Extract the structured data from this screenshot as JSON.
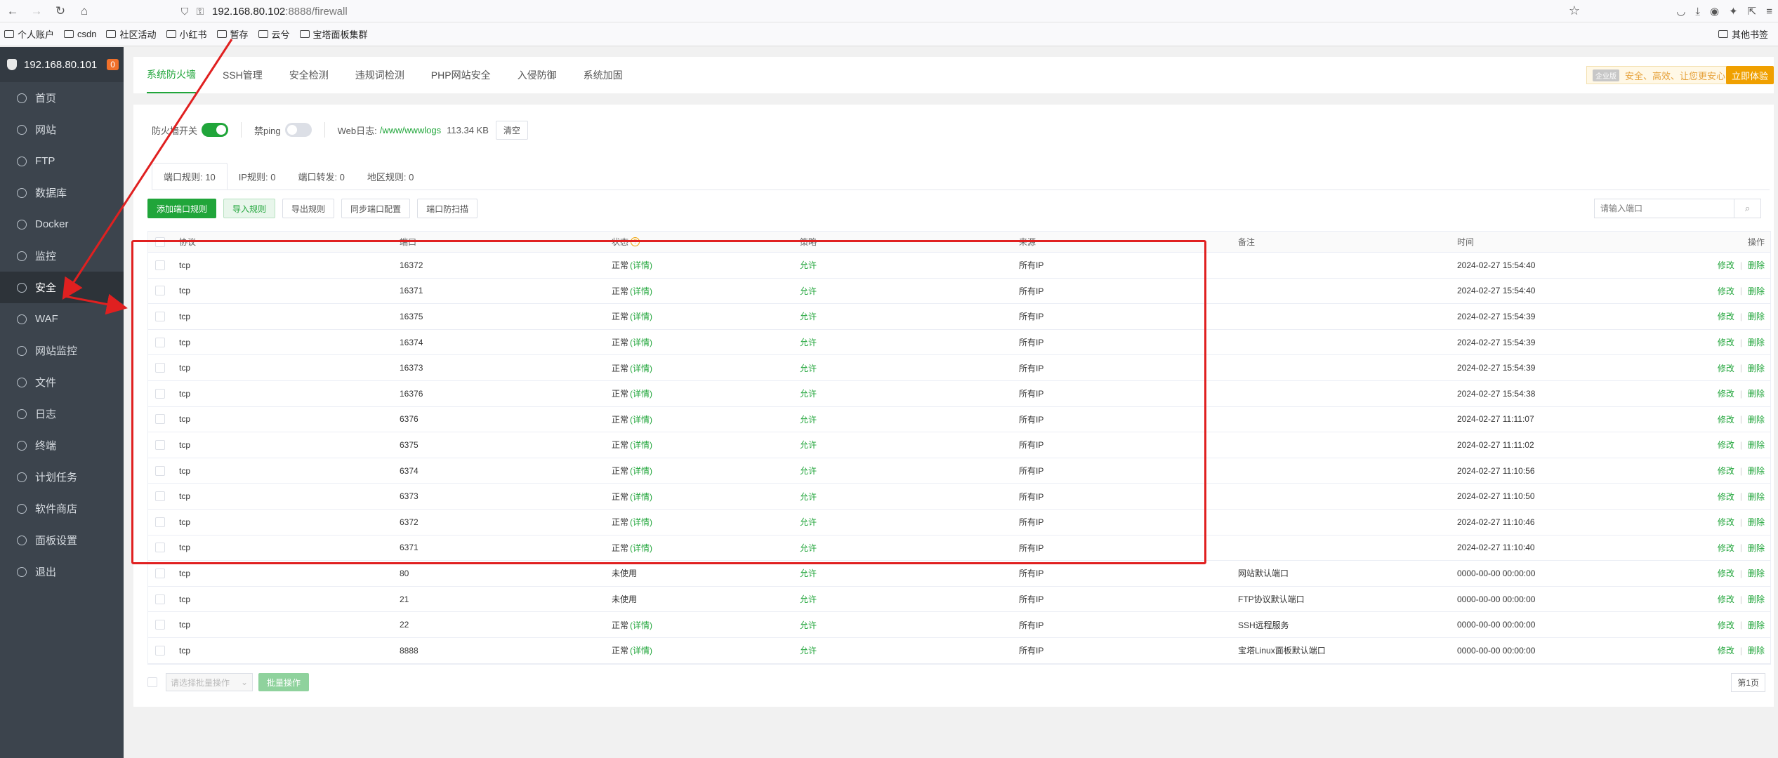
{
  "browser": {
    "url_host": "192.168.80.102",
    "url_rest": ":8888/firewall",
    "bookmarks": [
      "个人账户",
      "csdn",
      "社区活动",
      "小红书",
      "暂存",
      "云兮",
      "宝塔面板集群"
    ],
    "bookmark_right": "其他书签"
  },
  "sidebar": {
    "ip": "192.168.80.101",
    "badge": "0",
    "items": [
      {
        "label": "首页",
        "icon": "home-icon"
      },
      {
        "label": "网站",
        "icon": "globe-icon"
      },
      {
        "label": "FTP",
        "icon": "ftp-icon"
      },
      {
        "label": "数据库",
        "icon": "database-icon"
      },
      {
        "label": "Docker",
        "icon": "docker-icon"
      },
      {
        "label": "监控",
        "icon": "monitor-icon"
      },
      {
        "label": "安全",
        "icon": "shield-icon"
      },
      {
        "label": "WAF",
        "icon": "waf-icon"
      },
      {
        "label": "网站监控",
        "icon": "chart-icon"
      },
      {
        "label": "文件",
        "icon": "folder-icon"
      },
      {
        "label": "日志",
        "icon": "log-icon"
      },
      {
        "label": "终端",
        "icon": "terminal-icon"
      },
      {
        "label": "计划任务",
        "icon": "clock-icon"
      },
      {
        "label": "软件商店",
        "icon": "store-icon"
      },
      {
        "label": "面板设置",
        "icon": "gear-icon"
      },
      {
        "label": "退出",
        "icon": "logout-icon"
      }
    ],
    "active_index": 6
  },
  "topnav": {
    "tabs": [
      "系统防火墙",
      "SSH管理",
      "安全检测",
      "违规词检测",
      "PHP网站安全",
      "入侵防御",
      "系统加固"
    ],
    "enterprise_tag": "企业版",
    "enterprise_text": "安全、高效、让您更安心",
    "try_label": "立即体验"
  },
  "controls": {
    "firewall_label": "防火墙开关",
    "ping_label": "禁ping",
    "weblog_label": "Web日志:",
    "weblog_path": "/www/wwwlogs",
    "weblog_size": "113.34 KB",
    "clear_label": "清空"
  },
  "subtabs": [
    "端口规则: 10",
    "IP规则: 0",
    "端口转发: 0",
    "地区规则: 0"
  ],
  "buttons": {
    "add": "添加端口规则",
    "import": "导入规则",
    "export": "导出规则",
    "sync": "同步端口配置",
    "scan": "端口防扫描",
    "search_placeholder": "请输入端口"
  },
  "table": {
    "headers": [
      "协议",
      "端口",
      "状态",
      "策略",
      "来源",
      "备注",
      "时间",
      "操作"
    ],
    "rows": [
      {
        "proto": "tcp",
        "port": "16372",
        "status": "正常",
        "detail": "(详情)",
        "policy": "允许",
        "source": "所有IP",
        "note": "",
        "time": "2024-02-27 15:54:40"
      },
      {
        "proto": "tcp",
        "port": "16371",
        "status": "正常",
        "detail": "(详情)",
        "policy": "允许",
        "source": "所有IP",
        "note": "",
        "time": "2024-02-27 15:54:40"
      },
      {
        "proto": "tcp",
        "port": "16375",
        "status": "正常",
        "detail": "(详情)",
        "policy": "允许",
        "source": "所有IP",
        "note": "",
        "time": "2024-02-27 15:54:39"
      },
      {
        "proto": "tcp",
        "port": "16374",
        "status": "正常",
        "detail": "(详情)",
        "policy": "允许",
        "source": "所有IP",
        "note": "",
        "time": "2024-02-27 15:54:39"
      },
      {
        "proto": "tcp",
        "port": "16373",
        "status": "正常",
        "detail": "(详情)",
        "policy": "允许",
        "source": "所有IP",
        "note": "",
        "time": "2024-02-27 15:54:39"
      },
      {
        "proto": "tcp",
        "port": "16376",
        "status": "正常",
        "detail": "(详情)",
        "policy": "允许",
        "source": "所有IP",
        "note": "",
        "time": "2024-02-27 15:54:38"
      },
      {
        "proto": "tcp",
        "port": "6376",
        "status": "正常",
        "detail": "(详情)",
        "policy": "允许",
        "source": "所有IP",
        "note": "",
        "time": "2024-02-27 11:11:07"
      },
      {
        "proto": "tcp",
        "port": "6375",
        "status": "正常",
        "detail": "(详情)",
        "policy": "允许",
        "source": "所有IP",
        "note": "",
        "time": "2024-02-27 11:11:02"
      },
      {
        "proto": "tcp",
        "port": "6374",
        "status": "正常",
        "detail": "(详情)",
        "policy": "允许",
        "source": "所有IP",
        "note": "",
        "time": "2024-02-27 11:10:56"
      },
      {
        "proto": "tcp",
        "port": "6373",
        "status": "正常",
        "detail": "(详情)",
        "policy": "允许",
        "source": "所有IP",
        "note": "",
        "time": "2024-02-27 11:10:50"
      },
      {
        "proto": "tcp",
        "port": "6372",
        "status": "正常",
        "detail": "(详情)",
        "policy": "允许",
        "source": "所有IP",
        "note": "",
        "time": "2024-02-27 11:10:46"
      },
      {
        "proto": "tcp",
        "port": "6371",
        "status": "正常",
        "detail": "(详情)",
        "policy": "允许",
        "source": "所有IP",
        "note": "",
        "time": "2024-02-27 11:10:40"
      },
      {
        "proto": "tcp",
        "port": "80",
        "status": "未使用",
        "detail": "",
        "policy": "允许",
        "source": "所有IP",
        "note": "网站默认端口",
        "time": "0000-00-00 00:00:00"
      },
      {
        "proto": "tcp",
        "port": "21",
        "status": "未使用",
        "detail": "",
        "policy": "允许",
        "source": "所有IP",
        "note": "FTP协议默认端口",
        "time": "0000-00-00 00:00:00"
      },
      {
        "proto": "tcp",
        "port": "22",
        "status": "正常",
        "detail": "(详情)",
        "policy": "允许",
        "source": "所有IP",
        "note": "SSH远程服务",
        "time": "0000-00-00 00:00:00"
      },
      {
        "proto": "tcp",
        "port": "8888",
        "status": "正常",
        "detail": "(详情)",
        "policy": "允许",
        "source": "所有IP",
        "note": "宝塔Linux面板默认端口",
        "time": "0000-00-00 00:00:00"
      }
    ],
    "edit_label": "修改",
    "delete_label": "删除"
  },
  "footer": {
    "batch_select_placeholder": "请选择批量操作",
    "batch_button": "批量操作",
    "page": "第1页"
  },
  "colors": {
    "accent": "#20a53a",
    "annotation": "#e02020",
    "sidebar": "#3c444d"
  }
}
